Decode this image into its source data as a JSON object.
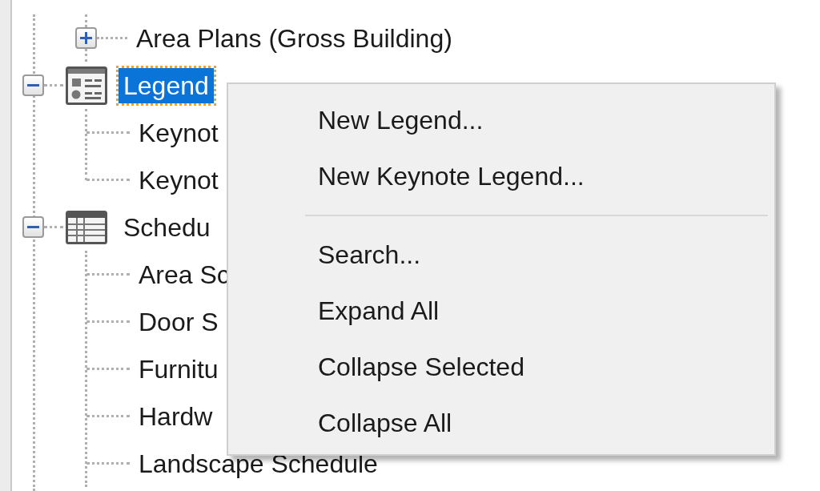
{
  "tree": {
    "continued_children": [
      {
        "label": "Area Plans (Gross Building)",
        "expanded": false,
        "selected": false
      }
    ],
    "items": [
      {
        "label": "Legend",
        "kind": "legend",
        "expanded": true,
        "selected": true,
        "children": [
          {
            "label": "Keynot",
            "selected": false
          },
          {
            "label": "Keynot",
            "selected": false
          }
        ]
      },
      {
        "label": "Schedu",
        "kind": "schedule",
        "expanded": true,
        "selected": false,
        "children": [
          {
            "label": "Area Sc",
            "selected": false
          },
          {
            "label": "Door S",
            "selected": false
          },
          {
            "label": "Furnitu",
            "selected": false
          },
          {
            "label": "Hardw",
            "selected": false
          },
          {
            "label": "Landscape Schedule",
            "selected": false
          }
        ]
      }
    ]
  },
  "context_menu": {
    "items": [
      {
        "kind": "item",
        "label": "New Legend..."
      },
      {
        "kind": "item",
        "label": "New Keynote Legend..."
      },
      {
        "kind": "separator"
      },
      {
        "kind": "item",
        "label": "Search..."
      },
      {
        "kind": "item",
        "label": "Expand All"
      },
      {
        "kind": "item",
        "label": "Collapse Selected"
      },
      {
        "kind": "item",
        "label": "Collapse All"
      }
    ]
  }
}
